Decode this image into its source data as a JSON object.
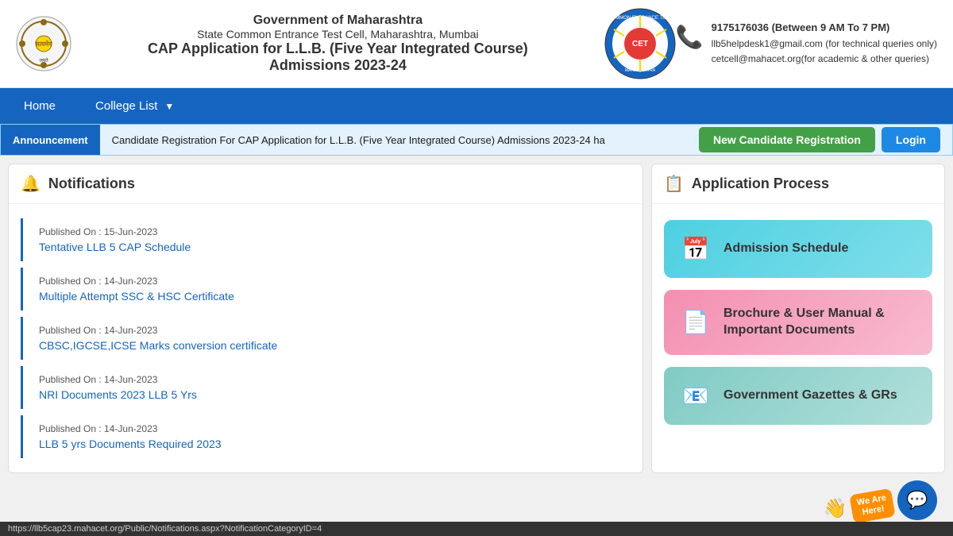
{
  "header": {
    "line1": "Government of Maharashtra",
    "line2": "State Common Entrance Test Cell, Maharashtra, Mumbai",
    "line3": "CAP Application for L.L.B. (Five Year Integrated Course)",
    "line4": "Admissions 2023-24",
    "phone": "9175176036 (Between 9 AM To 7 PM)",
    "email1": "llb5helpdesk1@gmail.com (for technical queries only)",
    "email2": "cetcell@mahacet.org(for academic & other queries)"
  },
  "navbar": {
    "home": "Home",
    "college_list": "College List"
  },
  "announcement": {
    "label": "Announcement",
    "text": "Candidate Registration For CAP Application for L.L.B. (Five Year Integrated Course) Admissions 2023-24 ha",
    "btn_register": "New Candidate Registration",
    "btn_login": "Login"
  },
  "notifications": {
    "title": "Notifications",
    "items": [
      {
        "date": "Published On : 15-Jun-2023",
        "link": "Tentative LLB 5 CAP Schedule"
      },
      {
        "date": "Published On : 14-Jun-2023",
        "link": "Multiple Attempt SSC & HSC Certificate"
      },
      {
        "date": "Published On : 14-Jun-2023",
        "link": "CBSC,IGCSE,ICSE Marks conversion certificate"
      },
      {
        "date": "Published On : 14-Jun-2023",
        "link": "NRI Documents 2023 LLB 5 Yrs"
      },
      {
        "date": "Published On : 14-Jun-2023",
        "link": "LLB 5 yrs Documents Required  2023"
      }
    ]
  },
  "application_process": {
    "title": "Application Process",
    "buttons": [
      {
        "icon": "📅",
        "label": "Admission Schedule",
        "style": "teal"
      },
      {
        "icon": "📄",
        "label": "Brochure & User Manual & Important Documents",
        "style": "pink"
      },
      {
        "icon": "📧",
        "label": "Government Gazettes & GRs",
        "style": "green"
      }
    ]
  },
  "status_bar": {
    "url": "https://llb5cap23.mahacet.org/Public/Notifications.aspx?NotificationCategoryID=4"
  },
  "we_are_here": {
    "text": "We Are\nHere!",
    "chat_icon": "💬",
    "hand_icon": "👋"
  }
}
